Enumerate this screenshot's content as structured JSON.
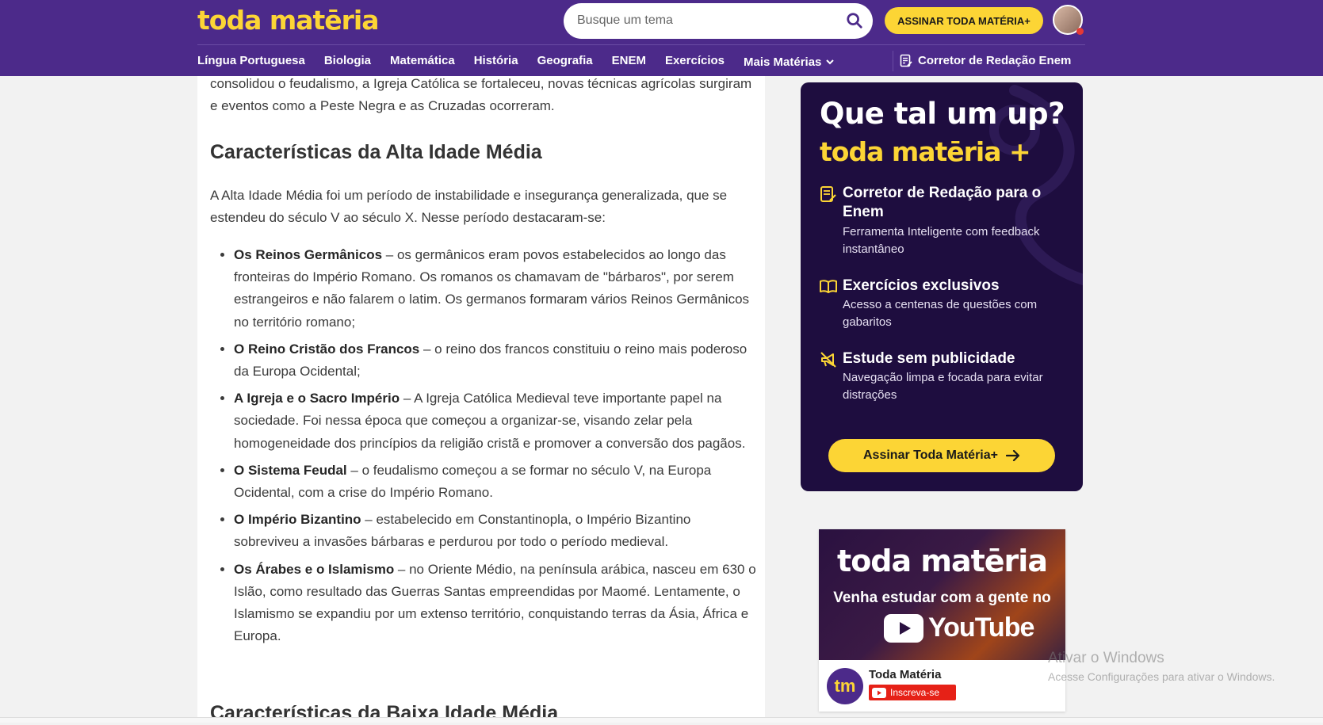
{
  "header": {
    "logo": "toda matēria",
    "search_placeholder": "Busque um tema",
    "subscribe_label": "ASSINAR TODA MATÉRIA+",
    "nav": [
      "Língua Portuguesa",
      "Biologia",
      "Matemática",
      "História",
      "Geografia",
      "ENEM",
      "Exercícios"
    ],
    "nav_more": "Mais Matérias",
    "corretor": "Corretor de Redação Enem"
  },
  "article": {
    "intro": "consolidou o feudalismo, a Igreja Católica se fortaleceu, novas técnicas agrícolas surgiram e eventos como a Peste Negra e as Cruzadas ocorreram.",
    "heading": "Características da Alta Idade Média",
    "paragraph": "A Alta Idade Média foi um período de instabilidade e insegurança generalizada, que se estendeu do século V ao século X. Nesse período destacaram-se:",
    "items": [
      {
        "term": "Os Reinos Germânicos",
        "text": " – os germânicos eram povos estabelecidos ao longo das fronteiras do Império Romano. Os romanos os chamavam de \"bárbaros\", por serem estrangeiros e não falarem o latim. Os germanos formaram vários Reinos Germânicos no território romano;"
      },
      {
        "term": "O Reino Cristão dos Francos",
        "text": " – o reino dos francos constituiu o reino mais poderoso da Europa Ocidental;"
      },
      {
        "term": "A Igreja e o Sacro Império",
        "text": " – A Igreja Católica Medieval teve importante papel na sociedade. Foi nessa época que começou a organizar-se, visando zelar pela homogeneidade dos princípios da religião cristã e promover a conversão dos pagãos."
      },
      {
        "term": "O Sistema Feudal",
        "text": " – o feudalismo começou a se formar no século V, na Europa Ocidental, com a crise do Império Romano."
      },
      {
        "term": "O Império Bizantino",
        "text": " – estabelecido em Constantinopla, o Império Bizantino sobreviveu a invasões bárbaras e perdurou por todo o período medieval."
      },
      {
        "term": "Os Árabes e o Islamismo",
        "text": " – no Oriente Médio, na península arábica, nasceu em 630 o Islão, como resultado das Guerras Santas empreendidas por Maomé. Lentamente, o Islamismo se expandiu por um extenso território, conquistando terras da Ásia, África e Europa."
      }
    ],
    "next_heading": "Características da Baixa Idade Média"
  },
  "promo": {
    "title": "Que tal um up?",
    "brand": "toda matēria +",
    "features": [
      {
        "icon": "document-edit-icon",
        "title": "Corretor de Redação para o Enem",
        "desc": "Ferramenta Inteligente com feedback instantâneo"
      },
      {
        "icon": "open-book-icon",
        "title": "Exercícios exclusivos",
        "desc": "Acesso a centenas de questões com gabaritos"
      },
      {
        "icon": "muted-megaphone-icon",
        "title": "Estude sem publicidade",
        "desc": "Navegação limpa e focada para evitar distrações"
      }
    ],
    "button": "Assinar Toda Matéria+"
  },
  "youtube": {
    "brand": "toda matēria",
    "tagline": "Venha estudar com a gente no",
    "logo_text": "YouTube",
    "avatar_text": "tm",
    "channel": "Toda Matéria",
    "subscribe": "Inscreva-se"
  },
  "watermark": {
    "title": "Ativar o Windows",
    "subtitle": "Acesse Configurações para ativar o Windows."
  },
  "colors": {
    "header_bg": "#4c2a8a",
    "accent_yellow": "#fcd535",
    "promo_bg": "#1e0d3f",
    "youtube_red": "#e62117"
  }
}
